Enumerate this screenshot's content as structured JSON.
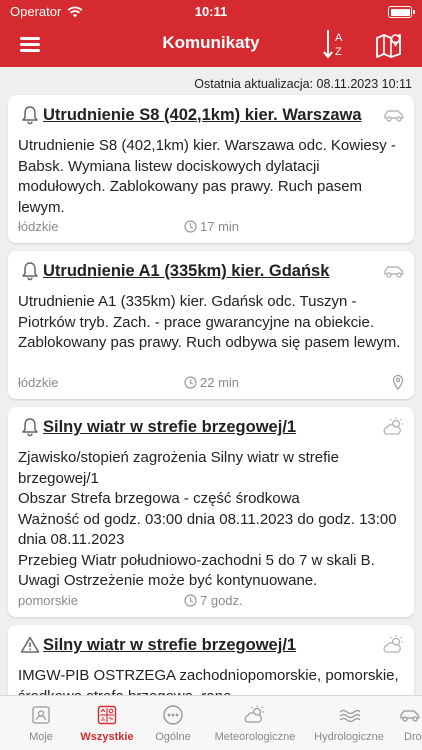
{
  "status_bar": {
    "carrier": "Operator",
    "time": "10:11"
  },
  "header": {
    "title": "Komunikaty",
    "sort_glyph_top": "A",
    "sort_glyph_bottom": "Z"
  },
  "update": {
    "text": "Ostatnia aktualizacja: 08.11.2023 10:11"
  },
  "cards": [
    {
      "title": "Utrudnienie S8 (402,1km) kier. Warszawa",
      "body": "Utrudnienie S8 (402,1km) kier. Warszawa odc. Kowiesy - Babsk. Wymiana listew dociskowych dylatacji modułowych. Zablokowany pas prawy. Ruch pasem lewym.",
      "region": "łódzkie",
      "time": "17 min"
    },
    {
      "title": "Utrudnienie A1 (335km) kier. Gdańsk",
      "body": "Utrudnienie A1 (335km) kier. Gdańsk odc. Tuszyn - Piotrków tryb. Zach. - prace gwarancyjne na obiekcie. Zablokowany pas prawy. Ruch odbywa się pasem lewym.",
      "region": "łódzkie",
      "time": "22 min"
    },
    {
      "title": "Silny wiatr w strefie brzegowej/1",
      "body_lines": [
        "Zjawisko/stopień zagrożenia Silny wiatr w strefie brzegowej/1",
        "Obszar Strefa brzegowa - część środkowa",
        "Ważność od godz. 03:00 dnia 08.11.2023 do godz. 13:00 dnia 08.11.2023",
        "Przebieg Wiatr południowo-zachodni 5 do 7 w skali B. Uwagi Ostrzeżenie może być kontynuowane."
      ],
      "region": "pomorskie",
      "time": "7 godz."
    },
    {
      "title": "Silny wiatr w strefie brzegowej/1",
      "body": "IMGW-PIB OSTRZEGA zachodniopomorskie, pomorskie, środkowa strefa brzegowa, rano"
    }
  ],
  "tabs": [
    {
      "label": "Moje"
    },
    {
      "label": "Wszystkie"
    },
    {
      "label": "Ogólne"
    },
    {
      "label": "Meteorologiczne"
    },
    {
      "label": "Hydrologiczne"
    },
    {
      "label": "Dro"
    }
  ],
  "colors": {
    "brand_red": "#d52b30",
    "muted_gray": "#8a8a8a",
    "background": "#efefef"
  },
  "icons": {
    "card_1": "bell-icon",
    "card_2": "bell-icon",
    "card_3": "bell-icon",
    "card_4": "warning-triangle-icon",
    "type_1": "car-icon",
    "type_2": "car-icon",
    "type_3": "weather-icon",
    "type_4": "weather-icon"
  }
}
